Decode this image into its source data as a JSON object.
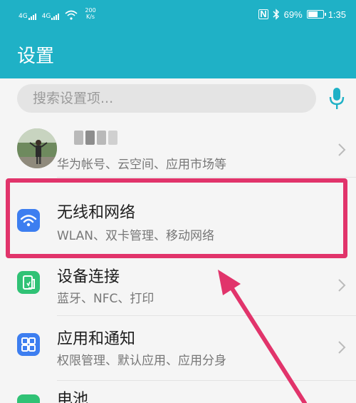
{
  "status_bar": {
    "signal1": "4G",
    "signal2": "4G",
    "speed_value": "200",
    "speed_unit": "K/s",
    "battery_percent": "69%",
    "battery_level": 0.69,
    "time": "1:35"
  },
  "header": {
    "title": "设置"
  },
  "search": {
    "placeholder": "搜索设置项..."
  },
  "account": {
    "subtitle": "华为帐号、云空间、应用市场等"
  },
  "settings": [
    {
      "title": "无线和网络",
      "subtitle": "WLAN、双卡管理、移动网络",
      "icon": "wifi-icon",
      "color": "#3d7ef0"
    },
    {
      "title": "设备连接",
      "subtitle": "蓝牙、NFC、打印",
      "icon": "device-connect-icon",
      "color": "#30c275"
    },
    {
      "title": "应用和通知",
      "subtitle": "权限管理、默认应用、应用分身",
      "icon": "apps-icon",
      "color": "#3d7ef0"
    },
    {
      "title": "电池",
      "icon": "battery-icon",
      "color": "#30c275"
    }
  ],
  "colors": {
    "header_bg": "#1fb1c6",
    "highlight": "#e1346b",
    "accent": "#1fb1c6"
  }
}
